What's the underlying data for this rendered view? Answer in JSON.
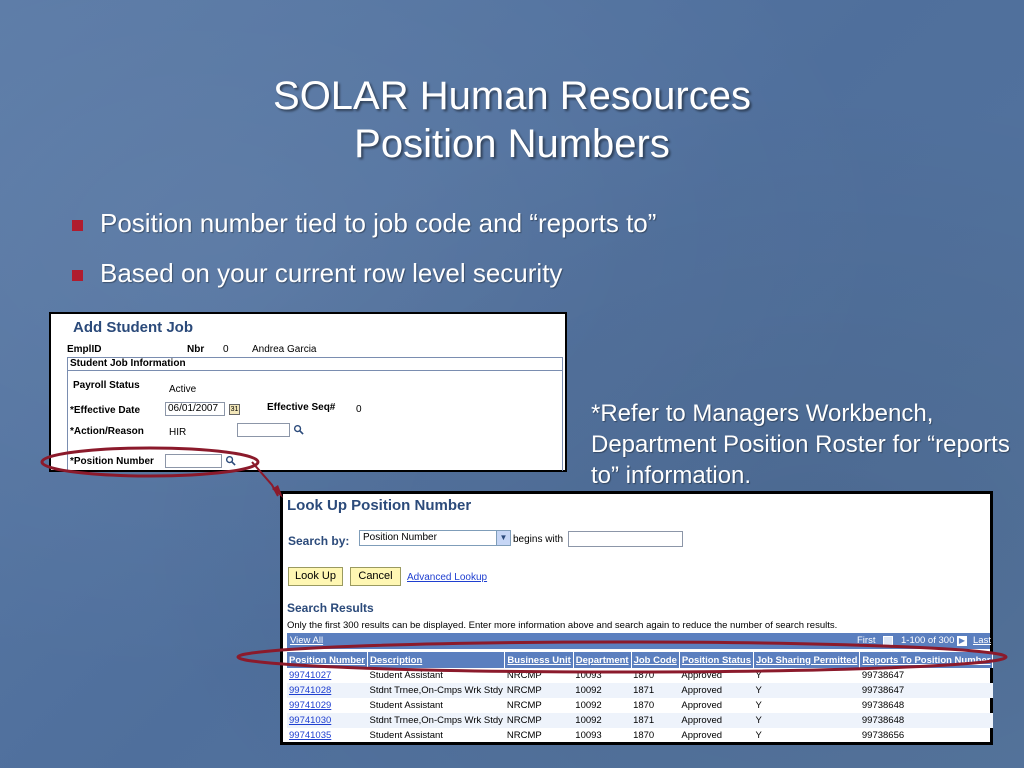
{
  "slide": {
    "title_line1": "SOLAR Human Resources",
    "title_line2": "Position Numbers",
    "bullets": [
      "Position number tied to job code and “reports to”",
      "Based on your current row level security"
    ],
    "note": "*Refer to Managers Workbench, Department Position Roster for “reports to” information."
  },
  "add_job": {
    "title": "Add Student Job",
    "emplid_label": "EmplID",
    "nbr_label": "Nbr",
    "nbr_value": "0",
    "name": "Andrea Garcia",
    "section_title": "Student Job Information",
    "payroll_status_label": "Payroll Status",
    "payroll_status_value": "Active",
    "effective_date_label": "*Effective Date",
    "effective_date_value": "06/01/2007",
    "effective_seq_label": "Effective Seq#",
    "effective_seq_value": "0",
    "action_reason_label": "*Action/Reason",
    "action_value": "HIR",
    "position_number_label": "*Position Number"
  },
  "lookup": {
    "title": "Look Up Position Number",
    "search_by_label": "Search by:",
    "search_by_value": "Position Number",
    "operator": "begins with",
    "lookup_button": "Look Up",
    "cancel_button": "Cancel",
    "advanced_link": "Advanced Lookup",
    "results_title": "Search Results",
    "results_message": "Only the first 300 results can be displayed. Enter more information above and search again to reduce the number of search results.",
    "view_all": "View All",
    "nav_first": "First",
    "nav_range": "1-100 of 300",
    "nav_last": "Last",
    "columns": [
      "Position Number",
      "Description",
      "Business Unit",
      "Department",
      "Job Code",
      "Position Status",
      "Job Sharing Permitted",
      "Reports To Position Number"
    ],
    "rows": [
      [
        "99741027",
        "Student Assistant",
        "NRCMP",
        "10093",
        "1870",
        "Approved",
        "Y",
        "99738647"
      ],
      [
        "99741028",
        "Stdnt Trnee,On-Cmps Wrk Stdy",
        "NRCMP",
        "10092",
        "1871",
        "Approved",
        "Y",
        "99738647"
      ],
      [
        "99741029",
        "Student Assistant",
        "NRCMP",
        "10092",
        "1870",
        "Approved",
        "Y",
        "99738648"
      ],
      [
        "99741030",
        "Stdnt Trnee,On-Cmps Wrk Stdy",
        "NRCMP",
        "10092",
        "1871",
        "Approved",
        "Y",
        "99738648"
      ],
      [
        "99741035",
        "Student Assistant",
        "NRCMP",
        "10093",
        "1870",
        "Approved",
        "Y",
        "99738656"
      ]
    ]
  },
  "colors": {
    "highlight": "#8b1a2b",
    "bullet": "#b01c2e",
    "header": "#5b7fbf",
    "title_blue": "#2b4a7a"
  }
}
